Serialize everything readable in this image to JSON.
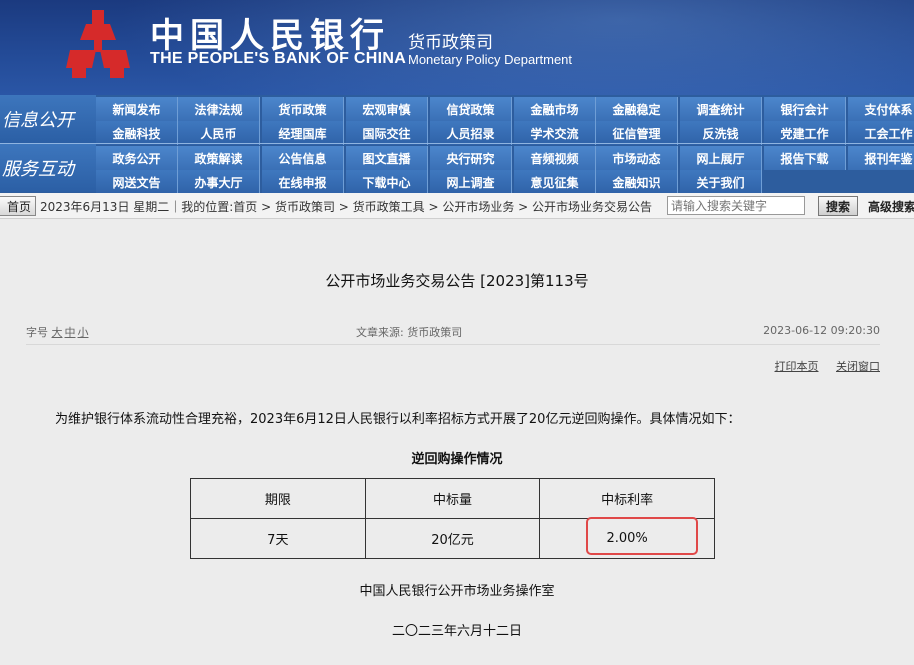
{
  "header": {
    "bank_name_cn": "中国人民银行",
    "bank_name_en": "THE PEOPLE'S BANK OF CHINA",
    "dept_cn": "货币政策司",
    "dept_en": "Monetary Policy Department"
  },
  "nav": {
    "section1_label": "信息公开",
    "section2_label": "服务互动",
    "rows": [
      [
        "新闻发布",
        "法律法规",
        "货币政策",
        "宏观审慎",
        "信贷政策",
        "金融市场",
        "金融稳定",
        "调查统计",
        "银行会计",
        "支付体系"
      ],
      [
        "金融科技",
        "人民币",
        "经理国库",
        "国际交往",
        "人员招录",
        "学术交流",
        "征信管理",
        "反洗钱",
        "党建工作",
        "工会工作"
      ],
      [
        "政务公开",
        "政策解读",
        "公告信息",
        "图文直播",
        "央行研究",
        "音频视频",
        "市场动态",
        "网上展厅",
        "报告下载",
        "报刊年鉴"
      ],
      [
        "网送文告",
        "办事大厅",
        "在线申报",
        "下载中心",
        "网上调查",
        "意见征集",
        "金融知识",
        "关于我们"
      ]
    ]
  },
  "crumb": {
    "home_label": "首页",
    "text": "2023年6月13日 星期二｜我的位置:首页 > 货币政策司 > 货币政策工具 > 公开市场业务 > 公开市场业务交易公告",
    "search_placeholder": "请输入搜索关键字",
    "search_button": "搜索",
    "advanced_search": "高级搜索"
  },
  "article": {
    "title": "公开市场业务交易公告 [2023]第113号",
    "font_size_label": "字号",
    "font_sizes": [
      "大",
      "中",
      "小"
    ],
    "source": "文章来源:  货币政策司",
    "datetime": "2023-06-12 09:20:30",
    "print_label": "打印本页",
    "close_label": "关闭窗口",
    "intro": "为维护银行体系流动性合理充裕，2023年6月12日人民银行以利率招标方式开展了20亿元逆回购操作。具体情况如下：",
    "table_title": "逆回购操作情况",
    "table_headers": [
      "期限",
      "中标量",
      "中标利率"
    ],
    "table_row": [
      "7天",
      "20亿元",
      "2.00%"
    ],
    "signature_org": "中国人民银行公开市场业务操作室",
    "signature_date": "二〇二三年六月十二日"
  },
  "colors": {
    "banner_blue": "#234a96",
    "nav_blue": "#3a70b6",
    "highlight_red": "#e04848"
  }
}
